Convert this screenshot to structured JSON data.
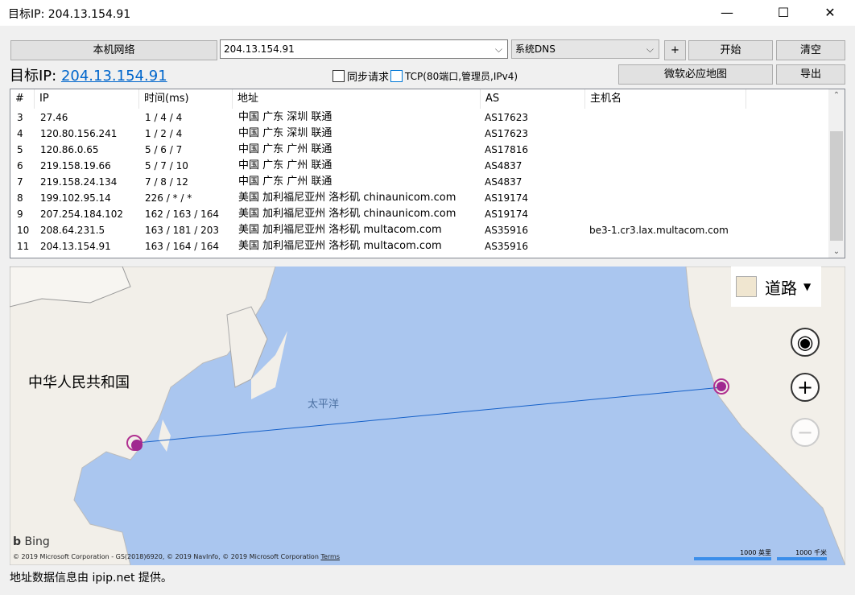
{
  "window": {
    "title": "目标IP: 204.13.154.91",
    "minimize": "—",
    "maximize": "☐",
    "close": "✕"
  },
  "toolbar": {
    "local_network": "本机网络",
    "target_input": "204.13.154.91",
    "dns": "系统DNS",
    "plus": "+",
    "start": "开始",
    "clear": "清空",
    "bing_map": "微软必应地图",
    "export": "导出"
  },
  "target": {
    "label": "目标IP: ",
    "ip": "204.13.154.91"
  },
  "options": {
    "sync": "同步请求",
    "tcp": "TCP(80端口,管理员,IPv4)"
  },
  "table": {
    "headers": [
      "#",
      "IP",
      "时间(ms)",
      "地址",
      "AS",
      "主机名"
    ],
    "rows": [
      {
        "n": "3",
        "ip": "27.46",
        "time": "1 / 4 / 4",
        "addr": "中国 广东 深圳 联通",
        "as": "AS17623",
        "host": ""
      },
      {
        "n": "4",
        "ip": "120.80.156.241",
        "time": "1 / 2 / 4",
        "addr": "中国 广东 深圳 联通",
        "as": "AS17623",
        "host": ""
      },
      {
        "n": "5",
        "ip": "120.86.0.65",
        "time": "5 / 6 / 7",
        "addr": "中国 广东 广州 联通",
        "as": "AS17816",
        "host": ""
      },
      {
        "n": "6",
        "ip": "219.158.19.66",
        "time": "5 / 7 / 10",
        "addr": "中国 广东 广州 联通",
        "as": "AS4837",
        "host": ""
      },
      {
        "n": "7",
        "ip": "219.158.24.134",
        "time": "7 / 8 / 12",
        "addr": "中国 广东 广州 联通",
        "as": "AS4837",
        "host": ""
      },
      {
        "n": "8",
        "ip": "199.102.95.14",
        "time": "226 / * / *",
        "addr": "美国 加利福尼亚州 洛杉矶 chinaunicom.com",
        "as": "AS19174",
        "host": ""
      },
      {
        "n": "9",
        "ip": "207.254.184.102",
        "time": "162 / 163 / 164",
        "addr": "美国 加利福尼亚州 洛杉矶 chinaunicom.com",
        "as": "AS19174",
        "host": ""
      },
      {
        "n": "10",
        "ip": "208.64.231.5",
        "time": "163 / 181 / 203",
        "addr": "美国 加利福尼亚州 洛杉矶 multacom.com",
        "as": "AS35916",
        "host": "be3-1.cr3.lax.multacom.com"
      },
      {
        "n": "11",
        "ip": "204.13.154.91",
        "time": "163 / 164 / 164",
        "addr": "美国 加利福尼亚州 洛杉矶 multacom.com",
        "as": "AS35916",
        "host": ""
      }
    ]
  },
  "map": {
    "style": "道路",
    "country": "中华人民共和国",
    "ocean": "太平洋",
    "bing": "Bing",
    "copyright": "© 2019 Microsoft Corporation - GS(2018)6920, © 2019 NavInfo, © 2019 Microsoft Corporation",
    "terms": "Terms",
    "scale_mi": "1000 英里",
    "scale_km": "1000 千米"
  },
  "status": {
    "prefix": "地址数据信息由 ",
    "link": "ipip.net",
    "suffix": " 提供。"
  }
}
